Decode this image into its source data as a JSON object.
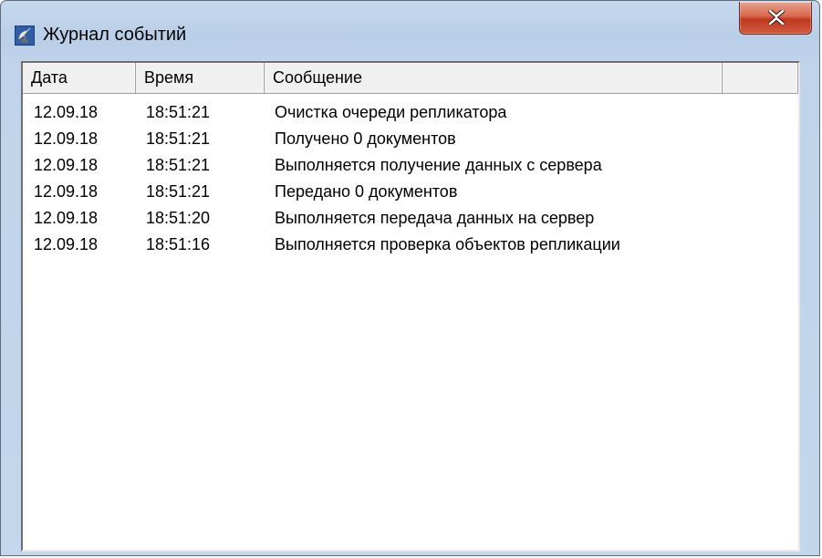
{
  "window": {
    "title": "Журнал событий",
    "icon": "satellite-dish-icon",
    "close_icon": "close-x-icon"
  },
  "columns": [
    {
      "label": "Дата"
    },
    {
      "label": "Время"
    },
    {
      "label": "Сообщение"
    },
    {
      "label": ""
    }
  ],
  "events": [
    {
      "date": "12.09.18",
      "time": "18:51:21",
      "message": "Очистка очереди репликатора"
    },
    {
      "date": "12.09.18",
      "time": "18:51:21",
      "message": "Получено 0 документов"
    },
    {
      "date": "12.09.18",
      "time": "18:51:21",
      "message": "Выполняется получение данных с сервера"
    },
    {
      "date": "12.09.18",
      "time": "18:51:21",
      "message": "Передано 0 документов"
    },
    {
      "date": "12.09.18",
      "time": "18:51:20",
      "message": "Выполняется передача данных на сервер"
    },
    {
      "date": "12.09.18",
      "time": "18:51:16",
      "message": "Выполняется проверка объектов репликации"
    }
  ],
  "colors": {
    "close_button": "#c0391f",
    "frame": "#bfd3ea"
  }
}
